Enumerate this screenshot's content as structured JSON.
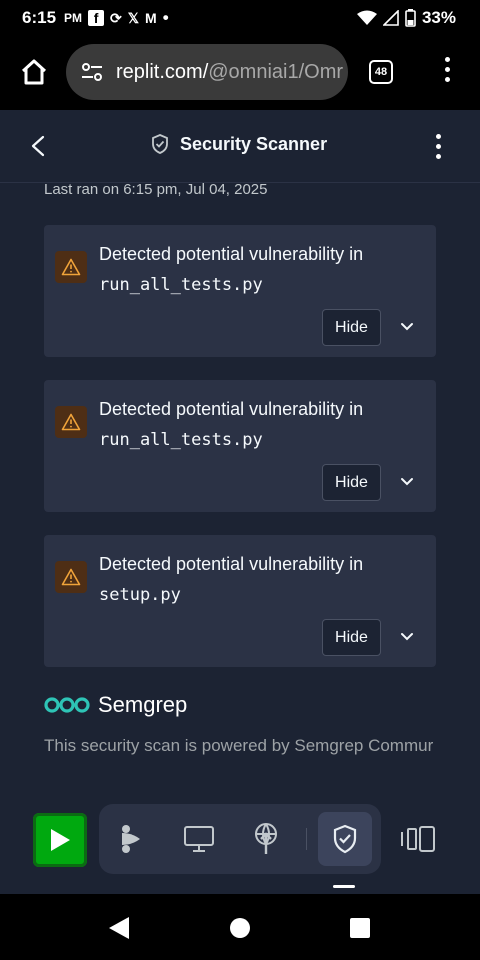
{
  "status_bar": {
    "time": "6:15",
    "ampm": "PM",
    "notif_icons": [
      "facebook-icon",
      "sync-icon",
      "x-icon",
      "gmail-icon"
    ],
    "dot": "•",
    "battery": "33%"
  },
  "browser": {
    "url_host": "replit.com/",
    "url_path": "@omniai1/Omr",
    "tab_count": "48"
  },
  "header": {
    "title": "Security Scanner"
  },
  "last_ran": "Last ran on 6:15 pm, Jul 04, 2025",
  "findings": [
    {
      "message": "Detected potential vulnerability in",
      "file": "run_all_tests.py",
      "hide_label": "Hide"
    },
    {
      "message": "Detected potential vulnerability in",
      "file": "run_all_tests.py",
      "hide_label": "Hide"
    },
    {
      "message": "Detected potential vulnerability in",
      "file": "setup.py",
      "hide_label": "Hide"
    }
  ],
  "semgrep": {
    "name": "Semgrep",
    "powered_by": "This security scan is powered by Semgrep Commur"
  },
  "colors": {
    "background": "#1c2333",
    "card": "#2b3245",
    "warning": "#f0a33a",
    "run_green": "#00a90f",
    "semgrep_teal": "#2ec4b6"
  }
}
